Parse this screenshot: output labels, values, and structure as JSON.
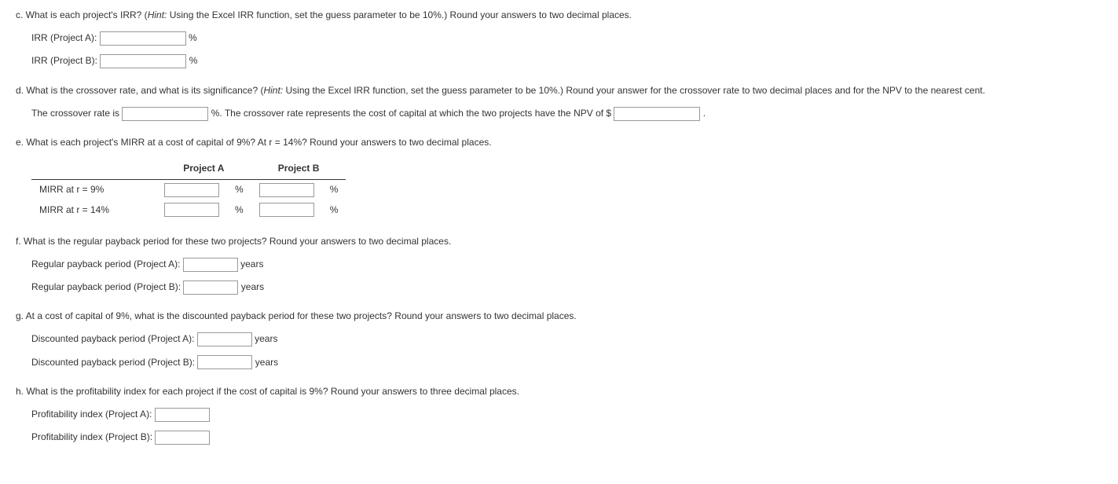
{
  "c": {
    "question": "c. What is each project's IRR? (",
    "hint_label": "Hint:",
    "hint_text": " Using the Excel IRR function, set the guess parameter to be 10%.) Round your answers to two decimal places.",
    "irr_a_label": "IRR (Project A): ",
    "irr_b_label": "IRR (Project B): ",
    "pct": "%"
  },
  "d": {
    "question": "d. What is the crossover rate, and what is its significance? (",
    "hint_label": "Hint:",
    "hint_text": " Using the Excel IRR function, set the guess parameter to be 10%.) Round your answer for the crossover rate to two decimal places and for the NPV to the nearest cent.",
    "pre_text": "The crossover rate is ",
    "mid_text": " %. The crossover rate represents the cost of capital at which the two projects have the NPV of $ ",
    "end_text": "."
  },
  "e": {
    "question": "e. What is each project's MIRR at a cost of capital of 9%? At r = 14%? Round your answers to two decimal places.",
    "header_a": "Project A",
    "header_b": "Project B",
    "row1_label": "MIRR at r = 9%",
    "row2_label": "MIRR at r = 14%",
    "pct": "%"
  },
  "f": {
    "question": "f. What is the regular payback period for these two projects? Round your answers to two decimal places.",
    "a_label": "Regular payback period (Project A): ",
    "b_label": "Regular payback period (Project B): ",
    "unit": " years"
  },
  "g": {
    "question": "g. At a cost of capital of 9%, what is the discounted payback period for these two projects? Round your answers to two decimal places.",
    "a_label": "Discounted payback period (Project A): ",
    "b_label": "Discounted payback period (Project B): ",
    "unit": " years"
  },
  "h": {
    "question": "h. What is the profitability index for each project if the cost of capital is 9%? Round your answers to three decimal places.",
    "a_label": "Profitability index (Project A): ",
    "b_label": "Profitability index (Project B): "
  }
}
